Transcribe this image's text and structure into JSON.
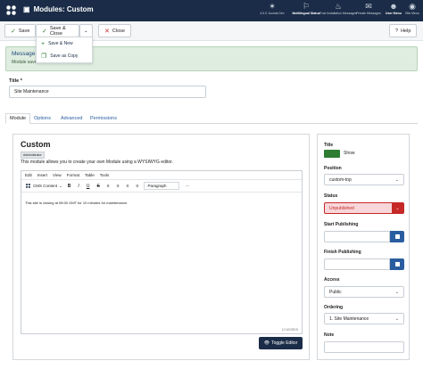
{
  "header": {
    "title": "Modules: Custom",
    "icons": [
      {
        "name": "joomla-version",
        "label": "4.0.0 Joomla Dev"
      },
      {
        "name": "multilingual-status",
        "label": "Multilingual Status"
      },
      {
        "name": "post-installation",
        "label": "Post Installation Messages"
      },
      {
        "name": "private-messages",
        "label": "Private Messages"
      },
      {
        "name": "user-menu",
        "label": "User Menu"
      },
      {
        "name": "site",
        "label": "Site Menu"
      }
    ]
  },
  "toolbar": {
    "save": "Save",
    "save_close": "Save & Close",
    "close": "Close",
    "help": "Help"
  },
  "dropdown": {
    "items": [
      "Save & New",
      "Save as Copy"
    ]
  },
  "message": {
    "heading": "Message",
    "text": "Module saved."
  },
  "form": {
    "title_label": "Title *",
    "title_value": "Site Maintenance"
  },
  "tabs": [
    "Module",
    "Options",
    "Advanced",
    "Permissions"
  ],
  "module": {
    "title": "Custom",
    "badge": "Administrator",
    "description": "This module allows you to create your own Module using a WYSIWYG editor."
  },
  "editor": {
    "menus": [
      "Edit",
      "Insert",
      "View",
      "Format",
      "Table",
      "Tools"
    ],
    "cms_content": "CMS Content",
    "format_select": "Paragraph",
    "content": "This site is closing at 08:00 GMT for 10 minutes for maintenance.",
    "word_count": "12 WORDS",
    "toggle_label": "Toggle Editor"
  },
  "sidebar": {
    "title_label": "Title",
    "show_label": "Show",
    "position_label": "Position",
    "position_value": "custom-top",
    "status_label": "Status",
    "status_value": "Unpublished",
    "start_label": "Start Publishing",
    "finish_label": "Finish Publishing",
    "access_label": "Access",
    "access_value": "Public",
    "ordering_label": "Ordering",
    "ordering_value": "1. Site Maintenance",
    "note_label": "Note"
  }
}
